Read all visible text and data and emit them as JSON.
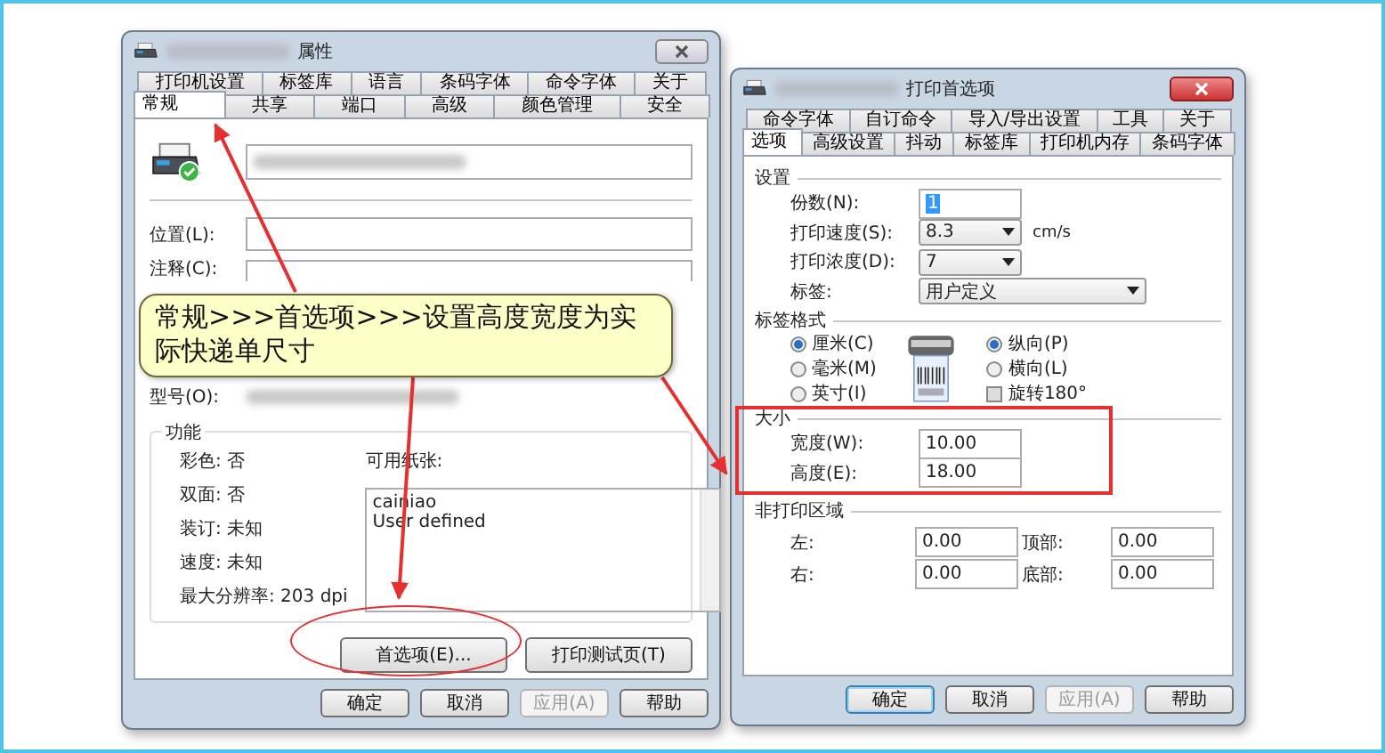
{
  "left_window": {
    "title": "属性",
    "tabs_row_1": [
      {
        "label": "打印机设置",
        "selected": false
      },
      {
        "label": "标签库",
        "selected": false
      },
      {
        "label": "语言",
        "selected": false
      },
      {
        "label": "条码字体",
        "selected": false
      },
      {
        "label": "命令字体",
        "selected": false
      },
      {
        "label": "关于",
        "selected": false
      }
    ],
    "tabs_row_2": [
      {
        "label": "常规",
        "selected": true
      },
      {
        "label": "共享",
        "selected": false
      },
      {
        "label": "端口",
        "selected": false
      },
      {
        "label": "高级",
        "selected": false
      },
      {
        "label": "颜色管理",
        "selected": false
      },
      {
        "label": "安全",
        "selected": false
      }
    ],
    "location_label": "位置(L):",
    "comment_label": "注释(C):",
    "model_label": "型号(O):",
    "features": {
      "title": "功能",
      "items": [
        "彩色: 否",
        "双面: 否",
        "装订: 未知",
        "速度: 未知",
        "最大分辨率: 203 dpi"
      ],
      "paper_label": "可用纸张:",
      "papers": [
        "cainiao",
        "User defined"
      ]
    },
    "preferences_button": "首选项(E)...",
    "test_page_button": "打印测试页(T)",
    "buttons": [
      {
        "label": "确定",
        "disabled": false
      },
      {
        "label": "取消",
        "disabled": false
      },
      {
        "label": "应用(A)",
        "disabled": true
      },
      {
        "label": "帮助",
        "disabled": false
      }
    ]
  },
  "right_window": {
    "title": "打印首选项",
    "tabs_row_1": [
      {
        "label": "命令字体",
        "selected": false
      },
      {
        "label": "自订命令",
        "selected": false
      },
      {
        "label": "导入/导出设置",
        "selected": false
      },
      {
        "label": "工具",
        "selected": false
      },
      {
        "label": "关于",
        "selected": false
      }
    ],
    "tabs_row_2": [
      {
        "label": "选项",
        "selected": true
      },
      {
        "label": "高级设置",
        "selected": false
      },
      {
        "label": "抖动",
        "selected": false
      },
      {
        "label": "标签库",
        "selected": false
      },
      {
        "label": "打印机内存",
        "selected": false
      },
      {
        "label": "条码字体",
        "selected": false
      }
    ],
    "settings": {
      "title": "设置",
      "copies": {
        "label": "份数(N):",
        "value": "1"
      },
      "speed": {
        "label": "打印速度(S):",
        "value": "8.3",
        "unit": "cm/s"
      },
      "darkness": {
        "label": "打印浓度(D):",
        "value": "7"
      },
      "label": {
        "label": "标签:",
        "value": "用户定义"
      }
    },
    "label_format": {
      "title": "标签格式",
      "units": [
        {
          "label": "厘米(C)",
          "selected": true
        },
        {
          "label": "毫米(M)",
          "selected": false
        },
        {
          "label": "英寸(I)",
          "selected": false
        }
      ],
      "orientation": [
        {
          "label": "纵向(P)",
          "selected": true
        },
        {
          "label": "横向(L)",
          "selected": false
        }
      ],
      "rotate": {
        "label": "旋转180°",
        "checked": false
      }
    },
    "size": {
      "title": "大小",
      "width": {
        "label": "宽度(W):",
        "value": "10.00"
      },
      "height": {
        "label": "高度(E):",
        "value": "18.00"
      }
    },
    "non_print_area": {
      "title": "非打印区域",
      "fields": [
        {
          "label": "左:",
          "value": "0.00"
        },
        {
          "label": "顶部:",
          "value": "0.00"
        },
        {
          "label": "右:",
          "value": "0.00"
        },
        {
          "label": "底部:",
          "value": "0.00"
        }
      ]
    },
    "buttons": [
      {
        "label": "确定",
        "disabled": false
      },
      {
        "label": "取消",
        "disabled": false
      },
      {
        "label": "应用(A)",
        "disabled": true
      },
      {
        "label": "帮助",
        "disabled": false
      }
    ]
  },
  "annotation": {
    "callout": "常规>>>首选项>>>设置高度宽度为实际快递单尺寸"
  }
}
